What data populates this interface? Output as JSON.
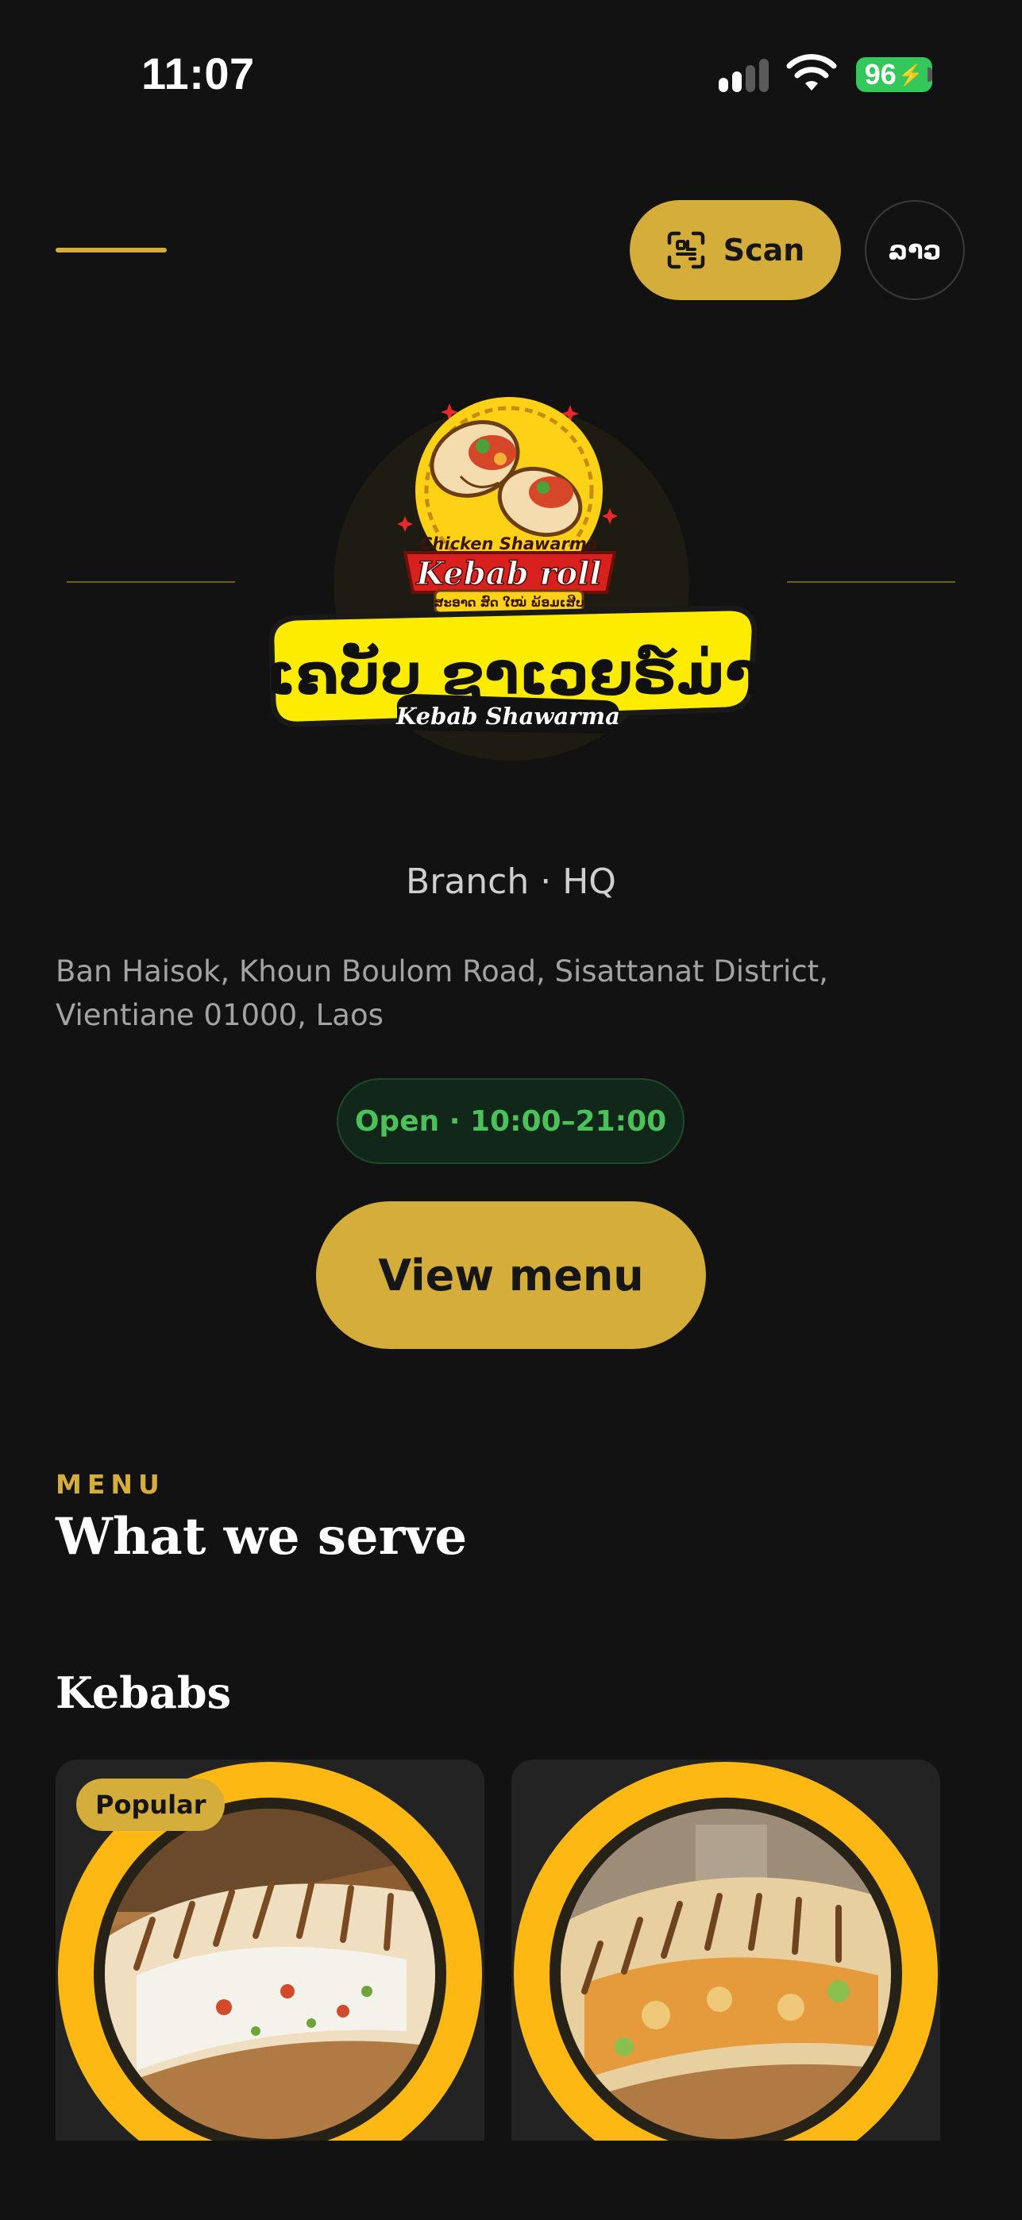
{
  "status_bar": {
    "time": "11:07",
    "battery": "96"
  },
  "header": {
    "scan_label": "Scan",
    "language_label": "ລາວ"
  },
  "logo": {
    "top_text": "Chicken Shawarma",
    "script_text": "Kebab roll",
    "tagline_lao": "ສະອາດ ສົດ ໃໝ່ ພ້ອມເສີບ",
    "title_lao": "ເຄບັບ ຊາເວຍຣ໌ມ່າ",
    "title_en": "Kebab Shawarma"
  },
  "store": {
    "branch": "Branch · HQ",
    "address": "Ban Haisok, Khoun Boulom Road, Sisattanat District, Vientiane 01000, Laos",
    "open_status": "Open · 10:00–21:00",
    "view_menu_label": "View menu"
  },
  "menu": {
    "eyebrow": "MENU",
    "title": "What we serve",
    "category": "Kebabs",
    "items": [
      {
        "badge": "Popular"
      },
      {
        "badge": ""
      }
    ]
  },
  "colors": {
    "accent": "#d4ad3b",
    "background": "#121212",
    "open_green": "#4cc05b",
    "ring_yellow": "#fdb813"
  }
}
